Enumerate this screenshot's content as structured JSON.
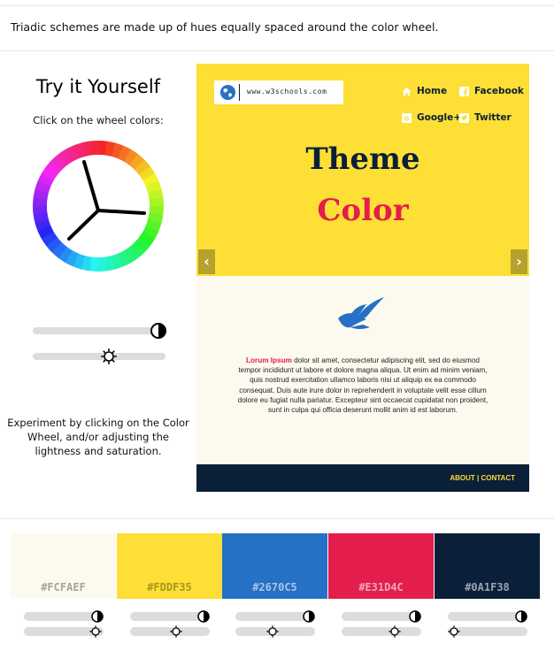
{
  "intro_text": "Triadic schemes are made up of hues equally spaced around the color wheel.",
  "left_panel": {
    "title": "Try it Yourself",
    "subtitle": "Click on the wheel colors:",
    "explain": "Experiment by clicking on the Color Wheel, and/or adjusting the lightness and saturation.",
    "lightness_icon": "contrast-icon",
    "saturation_icon": "sun-icon"
  },
  "preview": {
    "logo_text": "www.w3schools.com",
    "nav": {
      "home": "Home",
      "facebook": "Facebook",
      "googleplus": "Google+",
      "twitter": "Twitter"
    },
    "title_line1": "Theme",
    "title_line2": "Color",
    "lorem_lead": "Lorum Ipsum",
    "lorem_body": " dolor sit amet, consectetur adipiscing elit, sed do eiusmod tempor incididunt ut labore et dolore magna aliqua. Ut enim ad minim veniam, quis nostrud exercitation ullamco laboris nisi ut aliquip ex ea commodo consequat. Duis aute irure dolor in reprehenderit in voluptate velit esse cillum dolore eu fugiat nulla pariatur. Excepteur sint occaecat cupidatat non proident, sunt in culpa qui officia deserunt mollit anim id est laborum.",
    "footer_links": "ABOUT | CONTACT",
    "prev_arrow": "‹",
    "next_arrow": "›"
  },
  "swatches": [
    {
      "hex": "#FCFAEF",
      "color": "#FCFAEF",
      "text_color": "#a8a497"
    },
    {
      "hex": "#FDDF35",
      "color": "#FDDF35",
      "text_color": "#a89524"
    },
    {
      "hex": "#2670C5",
      "color": "#2670C5",
      "text_color": "#a8c4e6"
    },
    {
      "hex": "#E31D4C",
      "color": "#E31D4C",
      "text_color": "#f2a7b8"
    },
    {
      "hex": "#0A1F38",
      "color": "#0A1F38",
      "text_color": "#9aa4b0"
    }
  ],
  "colors": {
    "yellow": "#FDDF35",
    "cream": "#FCFAEF",
    "blue": "#2670C5",
    "red": "#E31D4C",
    "navy": "#0A1F38"
  }
}
